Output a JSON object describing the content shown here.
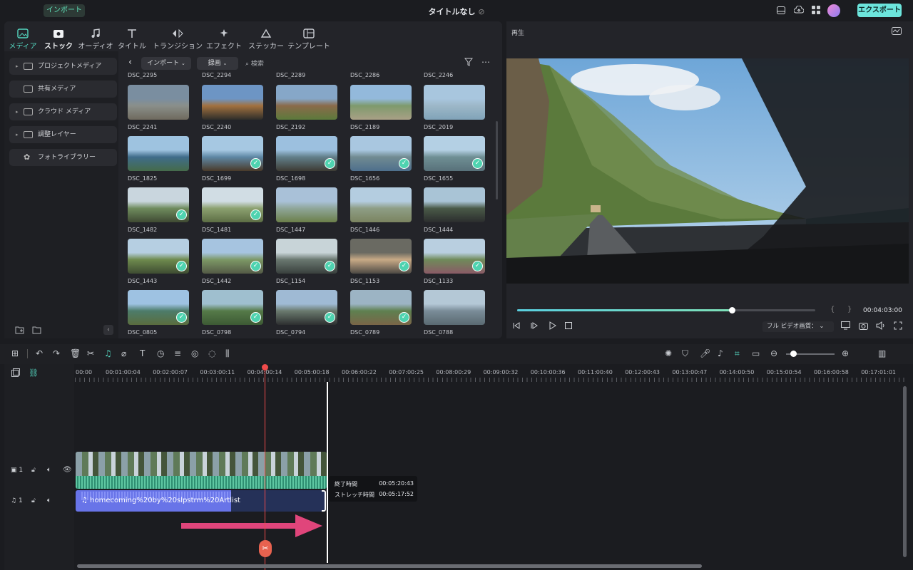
{
  "titlebar": {
    "import_label": "インポート",
    "title": "タイトルなし",
    "export_label": "エクスポート"
  },
  "tabs": [
    {
      "label": "メディア",
      "icon": "media-icon"
    },
    {
      "label": "ストック",
      "icon": "stock-icon"
    },
    {
      "label": "オーディオ",
      "icon": "audio-icon"
    },
    {
      "label": "タイトル",
      "icon": "title-icon"
    },
    {
      "label": "トランジション",
      "icon": "transition-icon"
    },
    {
      "label": "エフェクト",
      "icon": "effect-icon"
    },
    {
      "label": "ステッカー",
      "icon": "sticker-icon"
    },
    {
      "label": "テンプレート",
      "icon": "template-icon"
    }
  ],
  "sidebar": {
    "items": [
      {
        "label": "プロジェクトメディア",
        "expandable": true
      },
      {
        "label": "共有メディア",
        "expandable": false
      },
      {
        "label": "クラウド メディア",
        "expandable": true
      },
      {
        "label": "調整レイヤー",
        "expandable": true
      },
      {
        "label": "フォトライブラリー",
        "expandable": false
      }
    ]
  },
  "browser": {
    "import_dropdown": "インポート",
    "record_dropdown": "録画",
    "search_placeholder": "検索",
    "top_row_names": [
      "DSC_2295",
      "DSC_2294",
      "DSC_2289",
      "DSC_2286",
      "DSC_2246"
    ],
    "rows": [
      [
        {
          "name": "DSC_2241",
          "checked": false,
          "c": [
            "#7a8ea0",
            "#8a8f8a",
            "#6f6a5e"
          ]
        },
        {
          "name": "DSC_2240",
          "checked": false,
          "c": [
            "#6d95c4",
            "#a2713f",
            "#2e2d2a"
          ]
        },
        {
          "name": "DSC_2192",
          "checked": false,
          "c": [
            "#86a7c8",
            "#8a6a4a",
            "#5c7a3c"
          ]
        },
        {
          "name": "DSC_2189",
          "checked": false,
          "c": [
            "#93b9db",
            "#7e9a6c",
            "#a9a086"
          ]
        },
        {
          "name": "DSC_2019",
          "checked": false,
          "c": [
            "#a8c6de",
            "#9db7c8",
            "#80a3b8"
          ]
        }
      ],
      [
        {
          "name": "DSC_1825",
          "checked": false,
          "c": [
            "#9ec3e0",
            "#3f6c8a",
            "#456b4a"
          ]
        },
        {
          "name": "DSC_1699",
          "checked": true,
          "c": [
            "#a6c8e2",
            "#5e87a4",
            "#4a3a2a"
          ]
        },
        {
          "name": "DSC_1698",
          "checked": true,
          "c": [
            "#9cc0df",
            "#627f8a",
            "#3d3b34"
          ]
        },
        {
          "name": "DSC_1656",
          "checked": true,
          "c": [
            "#a9c7e0",
            "#718b92",
            "#4e6f8c"
          ]
        },
        {
          "name": "DSC_1655",
          "checked": true,
          "c": [
            "#b4d0e4",
            "#6f8f94",
            "#58717a"
          ]
        }
      ],
      [
        {
          "name": "DSC_1482",
          "checked": true,
          "c": [
            "#c9d6de",
            "#6f8c5e",
            "#3f4a33"
          ]
        },
        {
          "name": "DSC_1481",
          "checked": true,
          "c": [
            "#d1dde4",
            "#8ca170",
            "#5c6d44"
          ]
        },
        {
          "name": "DSC_1447",
          "checked": false,
          "c": [
            "#a9c1d8",
            "#8fa69a",
            "#6b7f4a"
          ]
        },
        {
          "name": "DSC_1446",
          "checked": false,
          "c": [
            "#b4cde0",
            "#8e9e86",
            "#7b8460"
          ]
        },
        {
          "name": "DSC_1444",
          "checked": false,
          "c": [
            "#a9c4d6",
            "#4a5a48",
            "#2b2d2e"
          ]
        }
      ],
      [
        {
          "name": "DSC_1443",
          "checked": true,
          "c": [
            "#b6cfe2",
            "#6e8a4e",
            "#3e4c32"
          ]
        },
        {
          "name": "DSC_1442",
          "checked": true,
          "c": [
            "#a6c4e0",
            "#7c9866",
            "#545a46"
          ]
        },
        {
          "name": "DSC_1154",
          "checked": true,
          "c": [
            "#c8d4d8",
            "#6a7870",
            "#39403d"
          ]
        },
        {
          "name": "DSC_1153",
          "checked": true,
          "c": [
            "#6a6a62",
            "#c8aa86",
            "#4d4a44"
          ]
        },
        {
          "name": "DSC_1133",
          "checked": true,
          "c": [
            "#b9cfe0",
            "#6f8a5a",
            "#8a5a66"
          ]
        }
      ],
      [
        {
          "name": "DSC_0805",
          "checked": true,
          "c": [
            "#9ec2e2",
            "#4d7c6a",
            "#5a6d3e"
          ]
        },
        {
          "name": "DSC_0798",
          "checked": true,
          "c": [
            "#9fbfcf",
            "#557a48",
            "#3d5a35"
          ]
        },
        {
          "name": "DSC_0794",
          "checked": true,
          "c": [
            "#9fbad4",
            "#6a7a6e",
            "#2d2f30"
          ]
        },
        {
          "name": "DSC_0789",
          "checked": true,
          "c": [
            "#9cb4c4",
            "#5e8050",
            "#7a6648"
          ]
        },
        {
          "name": "DSC_0788",
          "checked": false,
          "c": [
            "#b4c8d6",
            "#7a8c98",
            "#5a6a72"
          ]
        }
      ]
    ]
  },
  "player": {
    "label": "再生",
    "timecode": "00:04:03:00",
    "progress": 0.72,
    "quality": "フル ビデオ画質："
  },
  "ruler": [
    "00:00",
    "00:01:00:04",
    "00:02:00:07",
    "00:03:00:11",
    "00:04:00:14",
    "00:05:00:18",
    "00:06:00:22",
    "00:07:00:25",
    "00:08:00:29",
    "00:09:00:32",
    "00:10:00:36",
    "00:11:00:40",
    "00:12:00:43",
    "00:13:00:47",
    "00:14:00:50",
    "00:15:00:54",
    "00:16:00:58",
    "00:17:01:01"
  ],
  "tracks": {
    "video": {
      "index": "1"
    },
    "audio": {
      "index": "1",
      "clip_name": "homecoming%20by%20slpstrm%20Artlist"
    }
  },
  "tooltip": {
    "end_label": "終了時間",
    "end_value": "00:05:20:43",
    "stretch_label": "ストレッチ時間",
    "stretch_value": "00:05:17:52"
  },
  "colors": {
    "accent": "#55d9c2",
    "playhead": "#ef4b4b",
    "audio_clip": "#6874e8",
    "video_clip": "#3d8f78",
    "arrow": "#e0457b"
  }
}
